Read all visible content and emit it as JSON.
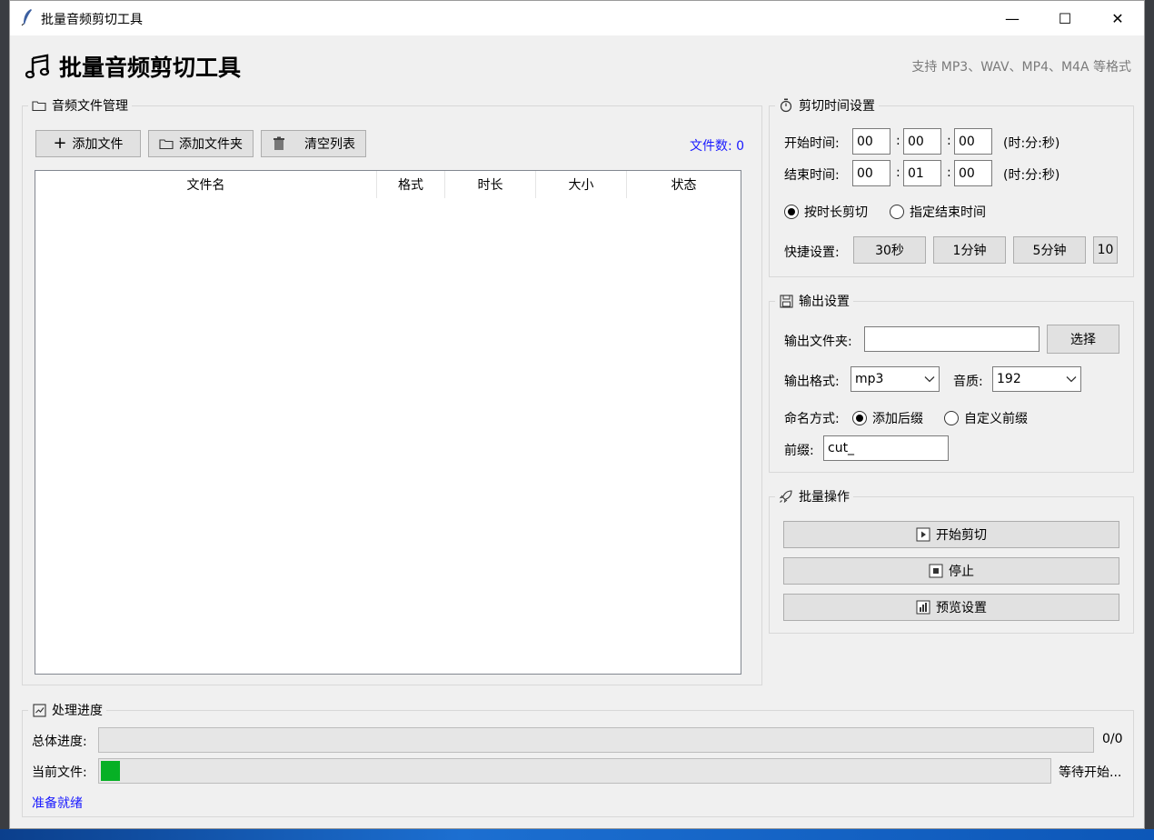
{
  "window": {
    "title": "批量音频剪切工具",
    "controls": {
      "minimize": "—",
      "maximize": "☐",
      "close": "✕"
    }
  },
  "header": {
    "title": "批量音频剪切工具",
    "subtitle": "支持 MP3、WAV、MP4、M4A 等格式"
  },
  "files": {
    "group_label": "音频文件管理",
    "add_file": "添加文件",
    "add_folder": "添加文件夹",
    "clear_list": "清空列表",
    "file_count": "文件数: 0",
    "columns": [
      "文件名",
      "格式",
      "时长",
      "大小",
      "状态"
    ]
  },
  "cut_time": {
    "group_label": "剪切时间设置",
    "start_label": "开始时间:",
    "start": [
      "00",
      "00",
      "00"
    ],
    "end_label": "结束时间:",
    "end": [
      "00",
      "01",
      "00"
    ],
    "unit_hint": "(时:分:秒)",
    "sep": ":",
    "mode_duration": "按时长剪切",
    "mode_end": "指定结束时间",
    "quick_label": "快捷设置:",
    "quick": [
      "30秒",
      "1分钟",
      "5分钟",
      "10"
    ]
  },
  "output": {
    "group_label": "输出设置",
    "folder_label": "输出文件夹:",
    "folder_value": "",
    "choose": "选择",
    "format_label": "输出格式:",
    "format_value": "mp3",
    "quality_label": "音质:",
    "quality_value": "192",
    "naming_label": "命名方式:",
    "naming_suffix": "添加后缀",
    "naming_prefix": "自定义前缀",
    "prefix_label": "前缀:",
    "prefix_value": "cut_"
  },
  "batch": {
    "group_label": "批量操作",
    "start": "开始剪切",
    "stop": "停止",
    "preview": "预览设置"
  },
  "progress": {
    "group_label": "处理进度",
    "overall_label": "总体进度:",
    "overall_value": "0/0",
    "overall_fraction": 0,
    "current_label": "当前文件:",
    "current_status": "等待开始...",
    "current_fraction": 0.02,
    "status": "准备就绪"
  }
}
